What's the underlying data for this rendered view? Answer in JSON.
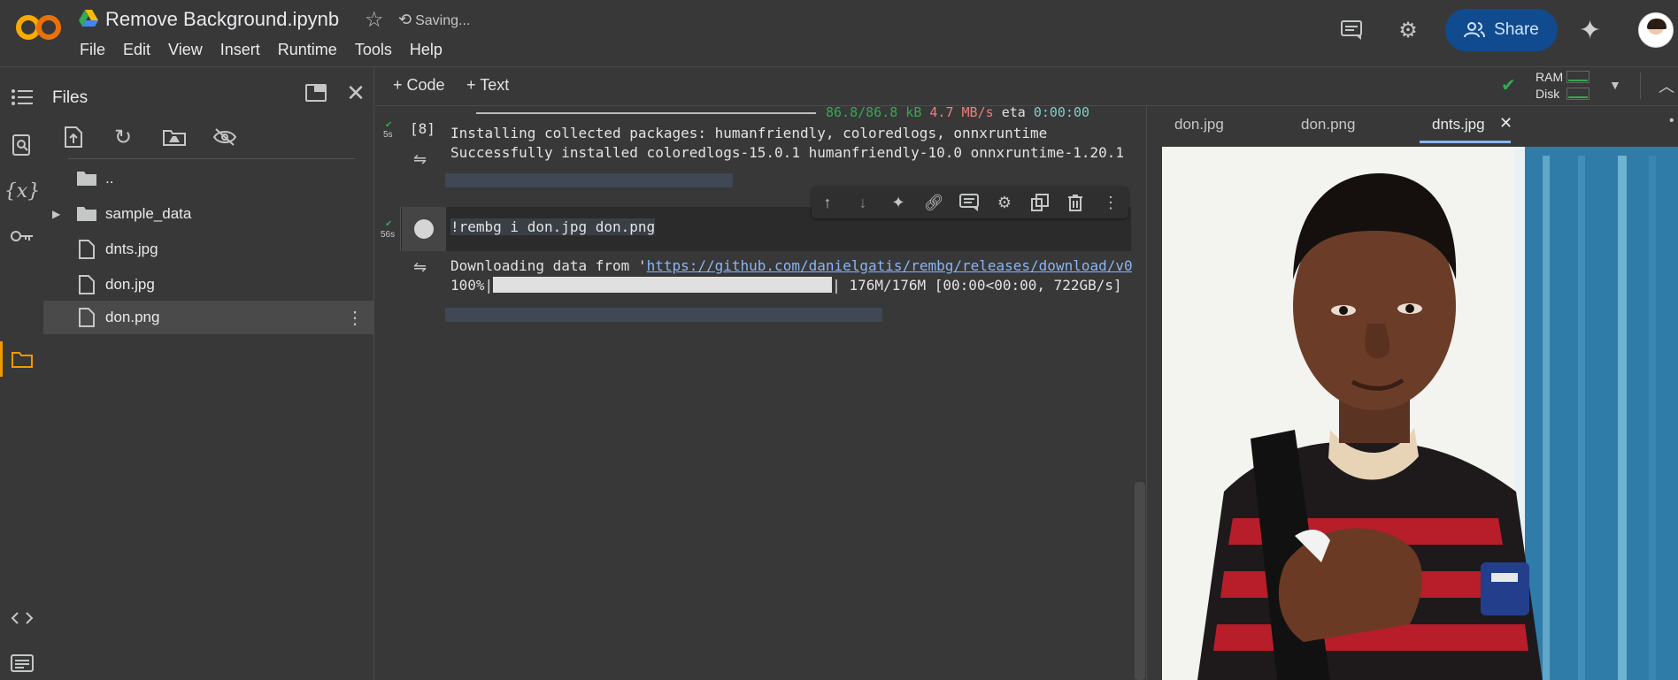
{
  "header": {
    "notebook_title": "Remove Background.ipynb",
    "status": "Saving...",
    "menu": [
      "File",
      "Edit",
      "View",
      "Insert",
      "Runtime",
      "Tools",
      "Help"
    ],
    "share_label": "Share",
    "icons": [
      "colab-logo",
      "drive-icon",
      "star-icon",
      "comment-icon",
      "gear-icon",
      "share-people-icon",
      "gemini-sparkle-icon",
      "avatar"
    ]
  },
  "rail": {
    "icons": [
      "toc-icon",
      "find-icon",
      "variables-icon",
      "key-icon",
      "folder-icon",
      "code-snippets-icon",
      "terminal-icon"
    ],
    "active": "folder-icon"
  },
  "files": {
    "title": "Files",
    "items": [
      {
        "label": "..",
        "icon": "folder-up-icon"
      },
      {
        "label": "sample_data",
        "icon": "folder-icon"
      },
      {
        "label": "dnts.jpg",
        "icon": "file-icon"
      },
      {
        "label": "don.jpg",
        "icon": "file-icon"
      },
      {
        "label": "don.png",
        "icon": "file-icon",
        "selected": true
      }
    ]
  },
  "toolbar": {
    "add_code": "+ Code",
    "add_text": "+ Text",
    "ram_label": "RAM",
    "disk_label": "Disk"
  },
  "cells": {
    "cell1": {
      "count": "[8]",
      "time": "5s",
      "progress_text": "86.8/86.8 kB",
      "speed": "4.7 MB/s",
      "eta_label": "eta",
      "eta_value": "0:00:00",
      "line1": "Installing collected packages: humanfriendly, coloredlogs, onnxruntime",
      "line2": "Successfully installed coloredlogs-15.0.1 humanfriendly-10.0 onnxruntime-1.20.1"
    },
    "cell2": {
      "time": "56s",
      "code": "!rembg i don.jpg don.png",
      "out_prefix": "Downloading data from '",
      "out_link": "https://github.com/danielgatis/rembg/releases/download/v0",
      "progress_prefix": "100%|",
      "progress_suffix": "| 176M/176M [00:00<00:00, 722GB/s]",
      "progress_fraction": 1.0
    }
  },
  "viewer": {
    "tabs": [
      "don.jpg",
      "don.png",
      "dnts.jpg"
    ],
    "active_tab": "dnts.jpg"
  },
  "colors": {
    "accent_blue": "#8ab4f8",
    "ok_green": "#34a853",
    "rail_active": "#f29900",
    "share_bg": "#104b8f"
  }
}
